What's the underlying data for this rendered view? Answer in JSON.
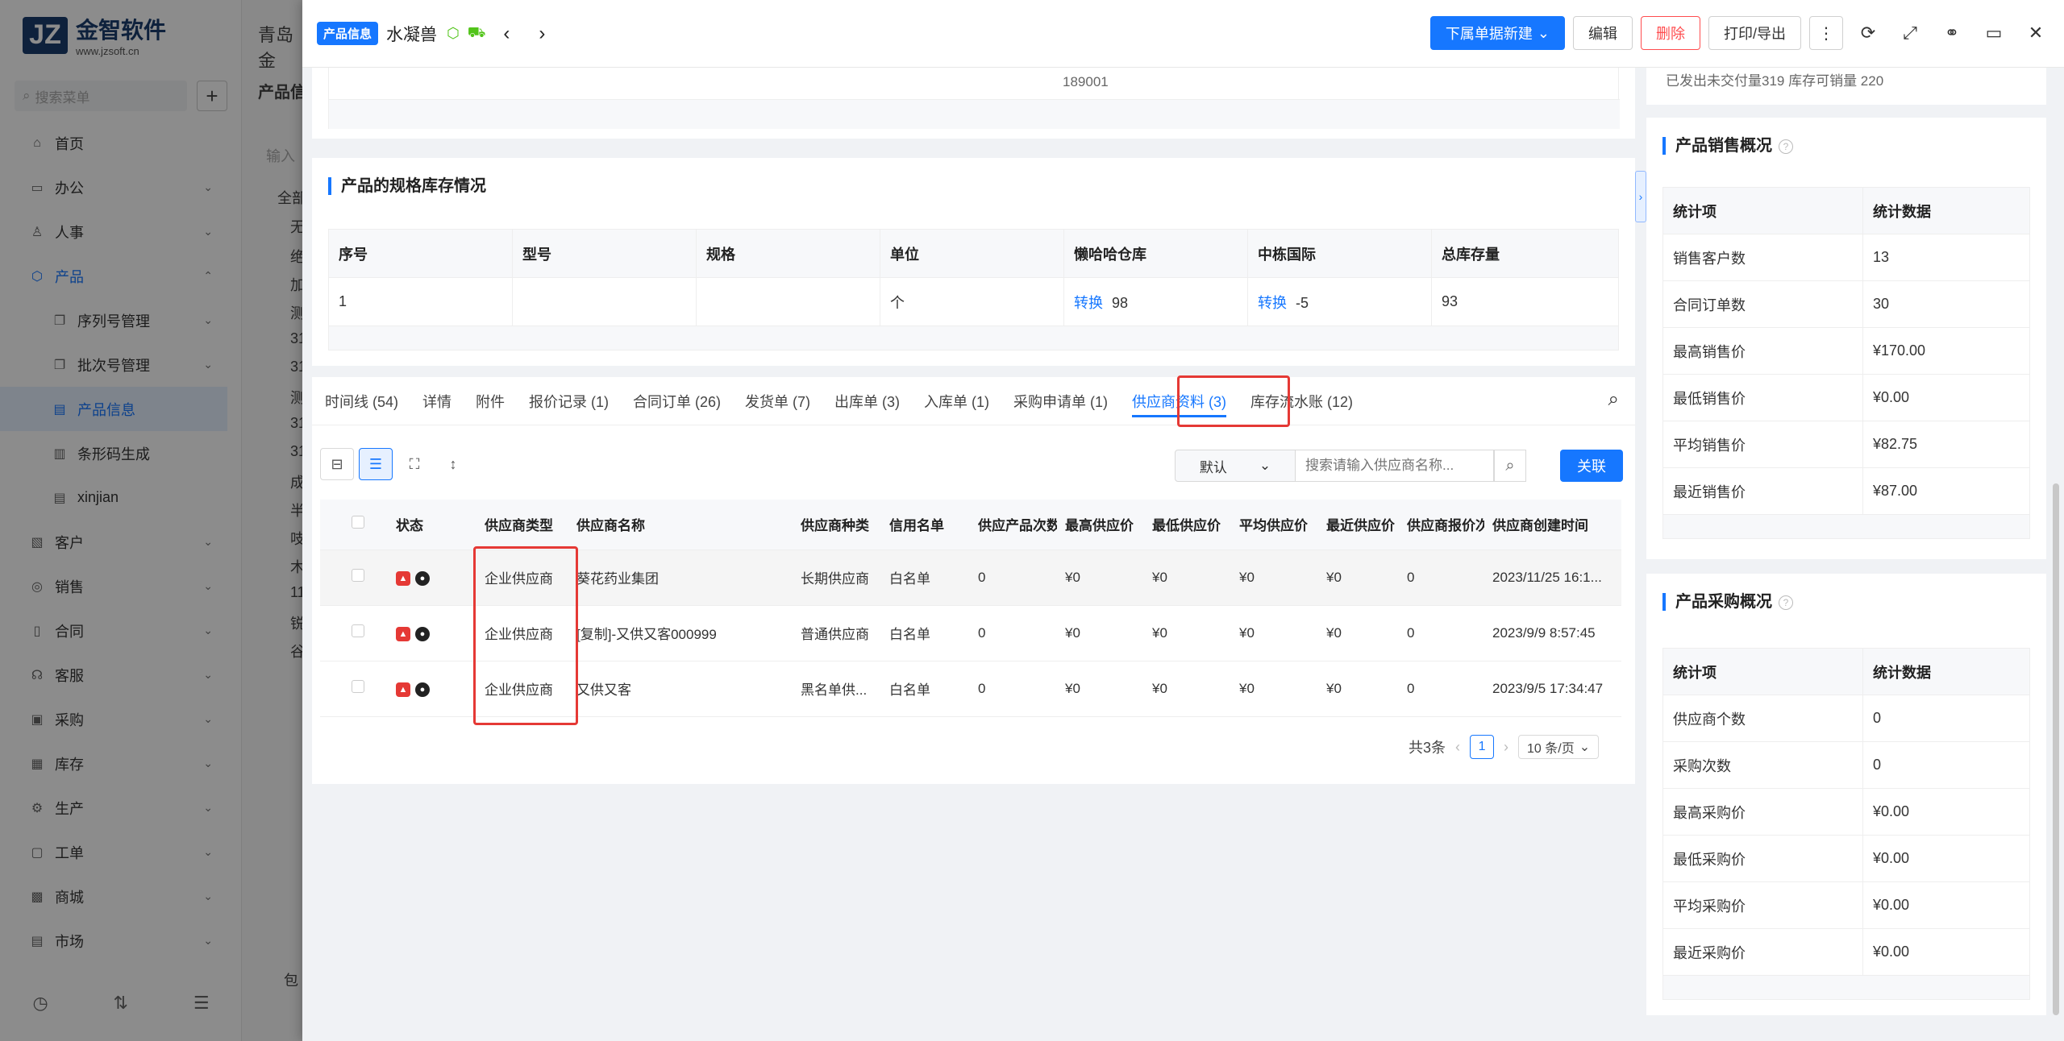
{
  "bg": {
    "logo_mark": "JZ",
    "logo_title": "金智软件",
    "logo_sub": "www.jzsoft.cn",
    "search_placeholder": "搜索菜单",
    "plus": "+",
    "col2_header": "青岛金",
    "col2_title": "产品信",
    "col2_input": "输入",
    "col2_rows": [
      "全部",
      "无",
      "绝",
      "加",
      "测",
      "31",
      "31",
      "测",
      "31",
      "31",
      "成",
      "半",
      "吱",
      "木",
      "11",
      "锐",
      "谷"
    ],
    "col2_bottom": "包",
    "menu": [
      {
        "label": "首页",
        "icon": "⌂",
        "chev": "",
        "type": "top"
      },
      {
        "label": "办公",
        "icon": "▭",
        "chev": "⌄",
        "type": "top"
      },
      {
        "label": "人事",
        "icon": "♙",
        "chev": "⌄",
        "type": "top"
      },
      {
        "label": "产品",
        "icon": "⬡",
        "chev": "⌃",
        "type": "active-parent"
      },
      {
        "label": "序列号管理",
        "icon": "❐",
        "chev": "⌄",
        "type": "sub"
      },
      {
        "label": "批次号管理",
        "icon": "❐",
        "chev": "⌄",
        "type": "sub"
      },
      {
        "label": "产品信息",
        "icon": "▤",
        "chev": "",
        "type": "selected"
      },
      {
        "label": "条形码生成",
        "icon": "▥",
        "chev": "",
        "type": "sub"
      },
      {
        "label": "xinjian",
        "icon": "▤",
        "chev": "",
        "type": "sub"
      },
      {
        "label": "客户",
        "icon": "▧",
        "chev": "⌄",
        "type": "top"
      },
      {
        "label": "销售",
        "icon": "◎",
        "chev": "⌄",
        "type": "top"
      },
      {
        "label": "合同",
        "icon": "▯",
        "chev": "⌄",
        "type": "top"
      },
      {
        "label": "客服",
        "icon": "☊",
        "chev": "⌄",
        "type": "top"
      },
      {
        "label": "采购",
        "icon": "▣",
        "chev": "⌄",
        "type": "top"
      },
      {
        "label": "库存",
        "icon": "▦",
        "chev": "⌄",
        "type": "top"
      },
      {
        "label": "生产",
        "icon": "⚙",
        "chev": "⌄",
        "type": "top"
      },
      {
        "label": "工单",
        "icon": "▢",
        "chev": "⌄",
        "type": "top"
      },
      {
        "label": "商城",
        "icon": "▩",
        "chev": "⌄",
        "type": "top"
      },
      {
        "label": "市场",
        "icon": "▤",
        "chev": "⌄",
        "type": "top"
      }
    ],
    "bottom_icons": [
      "◷",
      "⇅",
      "☰"
    ]
  },
  "header": {
    "badge": "产品信息",
    "title": "水凝兽",
    "icon_cube": "⬡",
    "icon_truck": "⛟",
    "prev": "‹",
    "next": "›",
    "btn_new": "下属单据新建",
    "btn_new_chev": "⌄",
    "btn_edit": "编辑",
    "btn_delete": "删除",
    "btn_print": "打印/导出",
    "btn_more": "⋮",
    "icons": [
      "⟳",
      "⤢",
      "⚭",
      "▭",
      "✕"
    ]
  },
  "top_partial": {
    "cell_value": "189001"
  },
  "spec_stock": {
    "title": "产品的规格库存情况",
    "headers": [
      "序号",
      "型号",
      "规格",
      "单位",
      "懒哈哈仓库",
      "中栋国际",
      "总库存量"
    ],
    "row": {
      "no": "1",
      "model": "",
      "spec": "",
      "unit": "个",
      "wh1_link": "转换",
      "wh1_qty": "98",
      "wh2_link": "转换",
      "wh2_qty": "-5",
      "total": "93"
    }
  },
  "tabs": {
    "items": [
      "时间线 (54)",
      "详情",
      "附件",
      "报价记录 (1)",
      "合同订单 (26)",
      "发货单 (7)",
      "出库单 (3)",
      "入库单 (1)",
      "采购申请单 (1)",
      "供应商资料 (3)",
      "库存流水账 (12)"
    ],
    "active_index": 9,
    "search_icon": "⌕"
  },
  "toolbar": {
    "icon_monitor": "⊟",
    "icon_list": "☰",
    "icon_expand": "⛶",
    "icon_height": "↕",
    "select_value": "默认",
    "select_chev": "⌄",
    "search_placeholder": "搜索请输入供应商名称...",
    "search_icon": "⌕",
    "btn_link": "关联"
  },
  "supplier_table": {
    "headers": [
      "状态",
      "供应商类型",
      "供应商名称",
      "供应商种类",
      "信用名单",
      "供应产品次数",
      "最高供应价",
      "最低供应价",
      "平均供应价",
      "最近供应价",
      "供应商报价次数",
      "供应商创建时间"
    ],
    "rows": [
      {
        "type": "企业供应商",
        "name": "葵花药业集团",
        "kind": "长期供应商",
        "credit": "白名单",
        "count": "0",
        "max": "¥0",
        "min": "¥0",
        "avg": "¥0",
        "recent": "¥0",
        "quotes": "0",
        "created": "2023/11/25 16:1..."
      },
      {
        "type": "企业供应商",
        "name": "[复制]-又供又客000999",
        "kind": "普通供应商",
        "credit": "白名单",
        "count": "0",
        "max": "¥0",
        "min": "¥0",
        "avg": "¥0",
        "recent": "¥0",
        "quotes": "0",
        "created": "2023/9/9 8:57:45"
      },
      {
        "type": "企业供应商",
        "name": "又供又客",
        "kind": "黑名单供...",
        "credit": "白名单",
        "count": "0",
        "max": "¥0",
        "min": "¥0",
        "avg": "¥0",
        "recent": "¥0",
        "quotes": "0",
        "created": "2023/9/5 17:34:47"
      }
    ],
    "status_red": "▲",
    "status_black": "●"
  },
  "pager": {
    "total": "共3条",
    "prev": "‹",
    "page": "1",
    "next": "›",
    "size": "10 条/页",
    "size_chev": "⌄"
  },
  "right_top": {
    "partial_text": "已发出未交付量319  库存可销量 220"
  },
  "sales_summary": {
    "title": "产品销售概况",
    "help": "?",
    "headers": [
      "统计项",
      "统计数据"
    ],
    "rows": [
      [
        "销售客户数",
        "13"
      ],
      [
        "合同订单数",
        "30"
      ],
      [
        "最高销售价",
        "¥170.00"
      ],
      [
        "最低销售价",
        "¥0.00"
      ],
      [
        "平均销售价",
        "¥82.75"
      ],
      [
        "最近销售价",
        "¥87.00"
      ]
    ]
  },
  "purchase_summary": {
    "title": "产品采购概况",
    "help": "?",
    "headers": [
      "统计项",
      "统计数据"
    ],
    "rows": [
      [
        "供应商个数",
        "0"
      ],
      [
        "采购次数",
        "0"
      ],
      [
        "最高采购价",
        "¥0.00"
      ],
      [
        "最低采购价",
        "¥0.00"
      ],
      [
        "平均采购价",
        "¥0.00"
      ],
      [
        "最近采购价",
        "¥0.00"
      ]
    ]
  },
  "collapse_handle": "›",
  "colors": {
    "accent": "#1677ff",
    "danger": "#ff4d4f",
    "highlight_box": "#e53935"
  }
}
